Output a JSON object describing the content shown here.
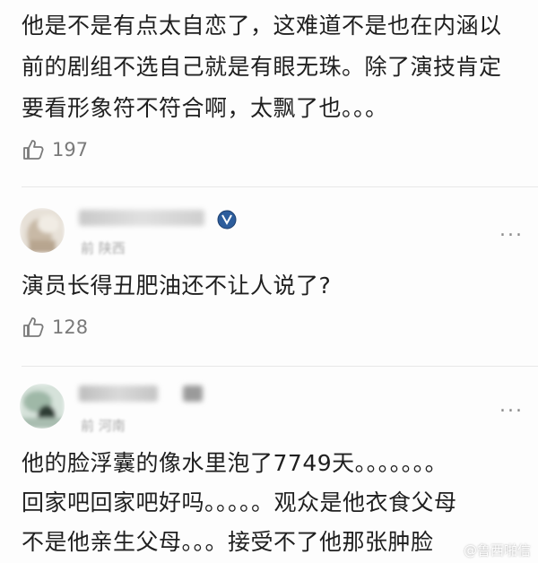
{
  "comment1": {
    "lines": [
      "他是不是有点太自恋了，这难道不是也在内涵以",
      "前的剧组不选自己就是有眼无珠。除了演技肯定",
      "要看形象符不符合啊，太飘了也。。。"
    ],
    "likes": "197"
  },
  "comment2": {
    "meta": "前  陕西",
    "text": "演员长得丑肥油还不让人说了?",
    "likes": "128",
    "more": "..."
  },
  "comment3": {
    "meta": "前  河南",
    "lines": [
      "他的脸浮囊的像水里泡了7749天。。。。。。。",
      "回家吧回家吧好吗。。。。。观众是他衣食父母",
      "不是他亲生父母。。。接受不了他那张肿脸"
    ],
    "more": "..."
  },
  "watermark": "@鲁西啪信",
  "icons": {
    "like": "thumbs-up-icon",
    "badge": "shield-badge-icon",
    "more": "more-dots-icon"
  },
  "colors": {
    "text": "#1f1f1f",
    "muted": "#7a7a7a",
    "badge": "#2d5d9c"
  }
}
